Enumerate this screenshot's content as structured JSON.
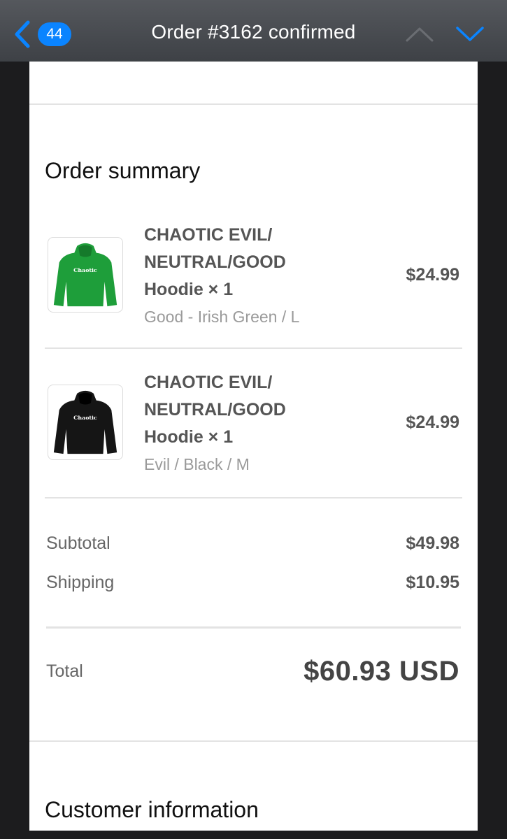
{
  "nav": {
    "back_count": "44",
    "title": "Order #3162 confirmed"
  },
  "order_summary": {
    "title": "Order summary",
    "items": [
      {
        "name_line1": "CHAOTIC EVIL/",
        "name_line2": "NEUTRAL/GOOD",
        "name_line3": "Hoodie × 1",
        "variant": "Good - Irish Green / L",
        "price": "$24.99",
        "hoodie_color": "#1e9e3a",
        "print_text": "Chaotic"
      },
      {
        "name_line1": "CHAOTIC EVIL/",
        "name_line2": "NEUTRAL/GOOD",
        "name_line3": "Hoodie × 1",
        "variant": "Evil / Black / M",
        "price": "$24.99",
        "hoodie_color": "#151515",
        "print_text": "Chaotic"
      }
    ],
    "subtotal_label": "Subtotal",
    "subtotal_value": "$49.98",
    "shipping_label": "Shipping",
    "shipping_value": "$10.95",
    "total_label": "Total",
    "total_value": "$60.93 USD"
  },
  "customer_information": {
    "title": "Customer information"
  },
  "colors": {
    "accent": "#0a84ff",
    "nav_bg": "#4a4d52",
    "text_dark": "#111111",
    "text_muted": "#9a9a9a"
  }
}
